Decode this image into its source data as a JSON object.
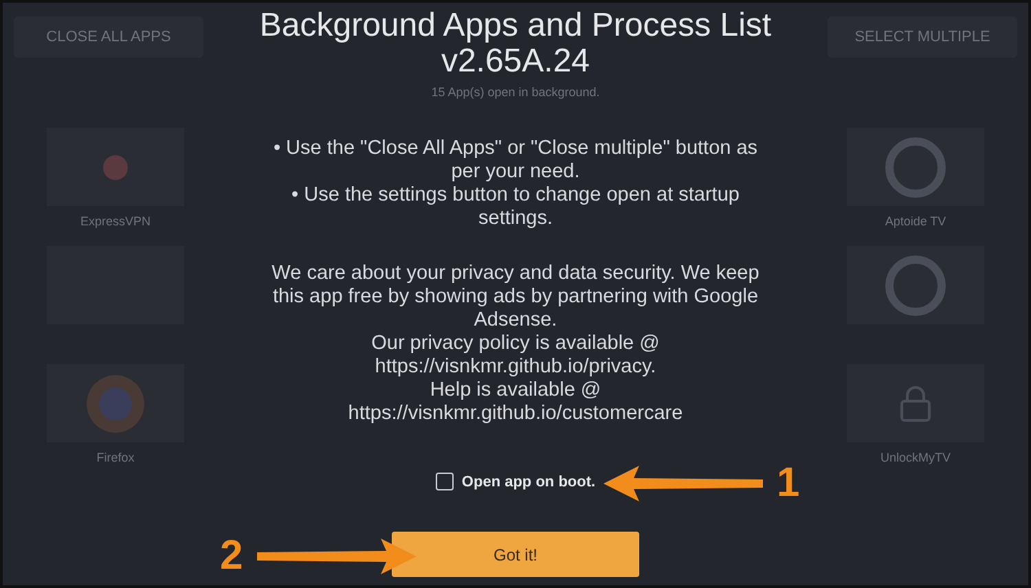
{
  "background": {
    "toolbar": [
      {
        "kind": "button",
        "label": "CLOSE ALL APPS"
      },
      {
        "kind": "button",
        "label": "SELECT MULTIPLE"
      }
    ],
    "status": "15 App(s) open in background.",
    "apps": [
      {
        "kind": "shield",
        "label": "ExpressVPN"
      },
      {
        "kind": "ring",
        "label": "Aptoide TV"
      },
      {
        "kind": "blank"
      },
      {
        "kind": "ring"
      },
      {
        "kind": "globe",
        "label": "Firefox"
      },
      {
        "kind": "lock",
        "label": "UnlockMyTV"
      }
    ]
  },
  "dialog": {
    "title": "Background Apps and Process List\nv2.65A.24",
    "tips": [
      "• Use the \"Close All Apps\" or \"Close multiple\" button as\nper your need.",
      "• Use the settings button to change open at startup\nsettings."
    ],
    "privacy": "We care about your privacy and data security. We keep\nthis app free by showing ads by partnering with Google\nAdsense.\nOur privacy policy is available @\nhttps://visnkmr.github.io/privacy.\nHelp is available @\nhttps://visnkmr.github.io/customercare",
    "checkbox": {
      "label": "Open app on boot.",
      "checked": false
    },
    "button": "Got it!"
  },
  "annotations": [
    {
      "number": "1"
    },
    {
      "number": "2"
    }
  ]
}
